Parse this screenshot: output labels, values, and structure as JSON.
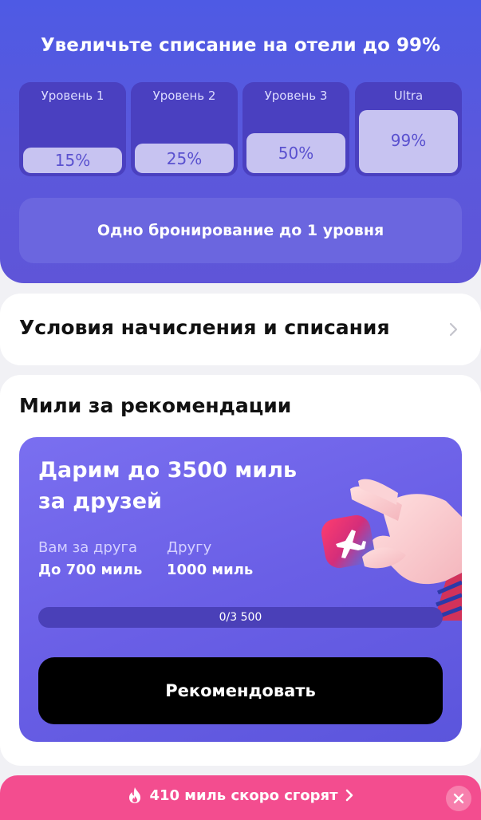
{
  "banner": {
    "title": "Увеличьте списание на отели до 99%",
    "levels": [
      {
        "label": "Уровень 1",
        "value": "15%"
      },
      {
        "label": "Уровень 2",
        "value": "25%"
      },
      {
        "label": "Уровень 3",
        "value": "50%"
      },
      {
        "label": "Ultra",
        "value": "99%"
      }
    ],
    "note": "Одно бронирование до 1 уровня"
  },
  "conditions": {
    "title": "Условия начисления и списания"
  },
  "referrals": {
    "title": "Мили за рекомендации",
    "promo": {
      "headline": "Дарим до 3500 миль за друзей",
      "you_label": "Вам за друга",
      "you_value": "До 700 миль",
      "friend_label": "Другу",
      "friend_value": "1000 миль",
      "progress_text": "0/3 500",
      "progress_fraction": 0,
      "button": "Рекомендовать"
    }
  },
  "expiry": {
    "message": "410 миль скоро сгорят"
  },
  "colors": {
    "brand": "#5b58dc",
    "alert": "#f34d8f"
  },
  "icons": {
    "chevron": "chevron-right-icon",
    "fire": "fire-icon",
    "close": "close-icon",
    "plane": "airplane-icon"
  }
}
